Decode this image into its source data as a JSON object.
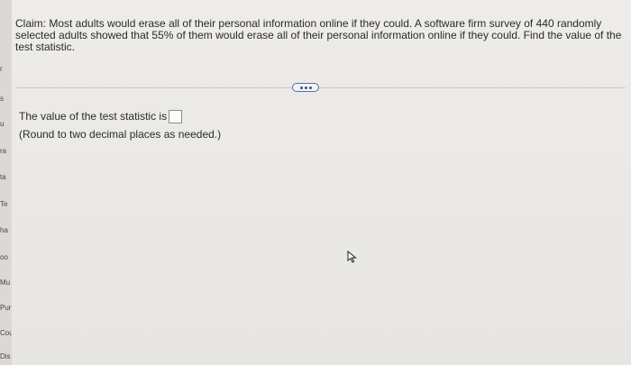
{
  "sidebar": {
    "fragments": [
      "r",
      "s",
      "u",
      "ra",
      "ta",
      "Te",
      "ha",
      "oo",
      "Mu",
      "Pur",
      "Cou",
      "Dis"
    ]
  },
  "question": {
    "text": "Claim: Most adults would erase all of their personal information online if they could. A software firm survey of 440 randomly selected adults showed that 55% of them would erase all of their personal information online if they could. Find the value of the test statistic."
  },
  "answer": {
    "label": "The value of the test statistic is",
    "value": "",
    "hint": "(Round to two decimal places as needed.)"
  }
}
